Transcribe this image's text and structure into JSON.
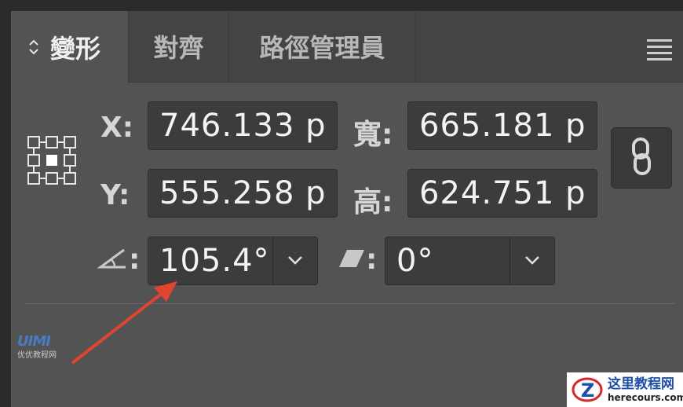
{
  "tabs": [
    {
      "label": "變形",
      "active": true
    },
    {
      "label": "對齊",
      "active": false
    },
    {
      "label": "路徑管理員",
      "active": false
    }
  ],
  "fields": {
    "x_label": "X:",
    "x_value": "746.133 p",
    "y_label": "Y:",
    "y_value": "555.258 p",
    "w_label": "寬:",
    "w_value": "665.181 p",
    "h_label": "高:",
    "h_value": "624.751 p",
    "rotate_label_suffix": ":",
    "rotate_value": "105.4°",
    "shear_label_suffix": ":",
    "shear_value": "0°"
  },
  "icons": {
    "tab_toggle": "up-down-arrows-icon",
    "panel_menu": "hamburger-menu-icon",
    "reference_point": "reference-point-grid-icon",
    "rotate": "rotate-angle-icon",
    "shear": "shear-parallelogram-icon",
    "constrain": "chain-link-icon",
    "dropdown": "chevron-down-icon"
  },
  "watermarks": {
    "left_logo": "UIMI",
    "left_text": "优优教程网",
    "right_title": "这里教程网",
    "right_url": "herecours.com"
  },
  "colors": {
    "panel_bg": "#535353",
    "tabbar_bg": "#444444",
    "field_bg": "#3c3c3c",
    "annotation_arrow": "#e0452f"
  }
}
